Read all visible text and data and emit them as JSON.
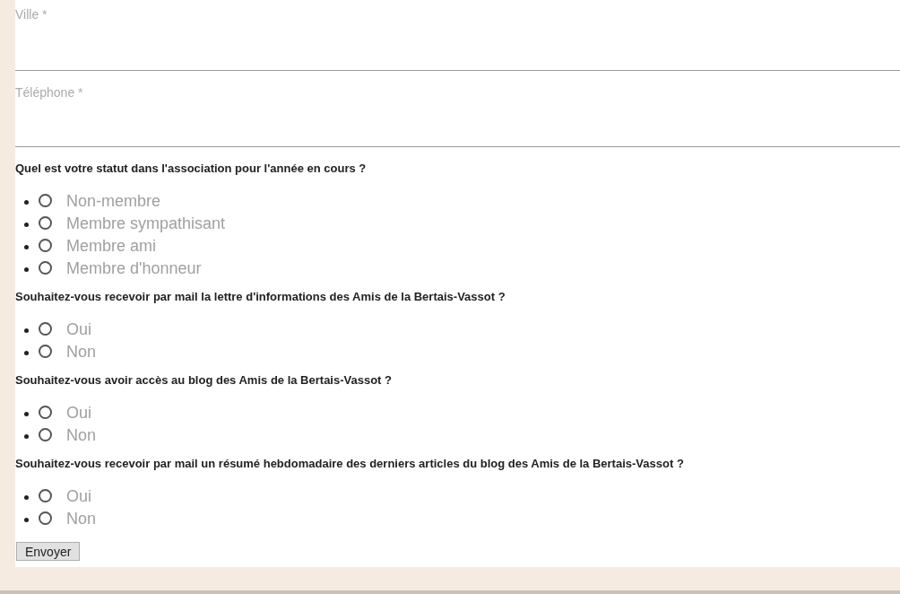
{
  "fields": [
    {
      "placeholder": "Ville *"
    },
    {
      "placeholder": "Téléphone *"
    }
  ],
  "questions": [
    {
      "text": "Quel est votre statut dans l'association pour l'année en cours ?",
      "options": [
        {
          "label": "Non-membre",
          "selected": false
        },
        {
          "label": "Membre sympathisant",
          "selected": false
        },
        {
          "label": "Membre ami",
          "selected": false
        },
        {
          "label": "Membre d'honneur",
          "selected": false
        }
      ]
    },
    {
      "text": "Souhaitez-vous recevoir par mail la lettre d'informations des Amis de la Bertais-Vassot ?",
      "options": [
        {
          "label": "Oui",
          "selected": false
        },
        {
          "label": "Non",
          "selected": false
        }
      ]
    },
    {
      "text": "Souhaitez-vous avoir accès au blog des Amis de la Bertais-Vassot ?",
      "options": [
        {
          "label": "Oui",
          "selected": false
        },
        {
          "label": "Non",
          "selected": false
        }
      ]
    },
    {
      "text": "Souhaitez-vous recevoir par mail un résumé hebdomadaire des derniers articles du blog des Amis de la Bertais-Vassot ?",
      "options": [
        {
          "label": "Oui",
          "selected": false
        },
        {
          "label": "Non",
          "selected": false
        }
      ]
    }
  ],
  "submit": "Envoyer"
}
